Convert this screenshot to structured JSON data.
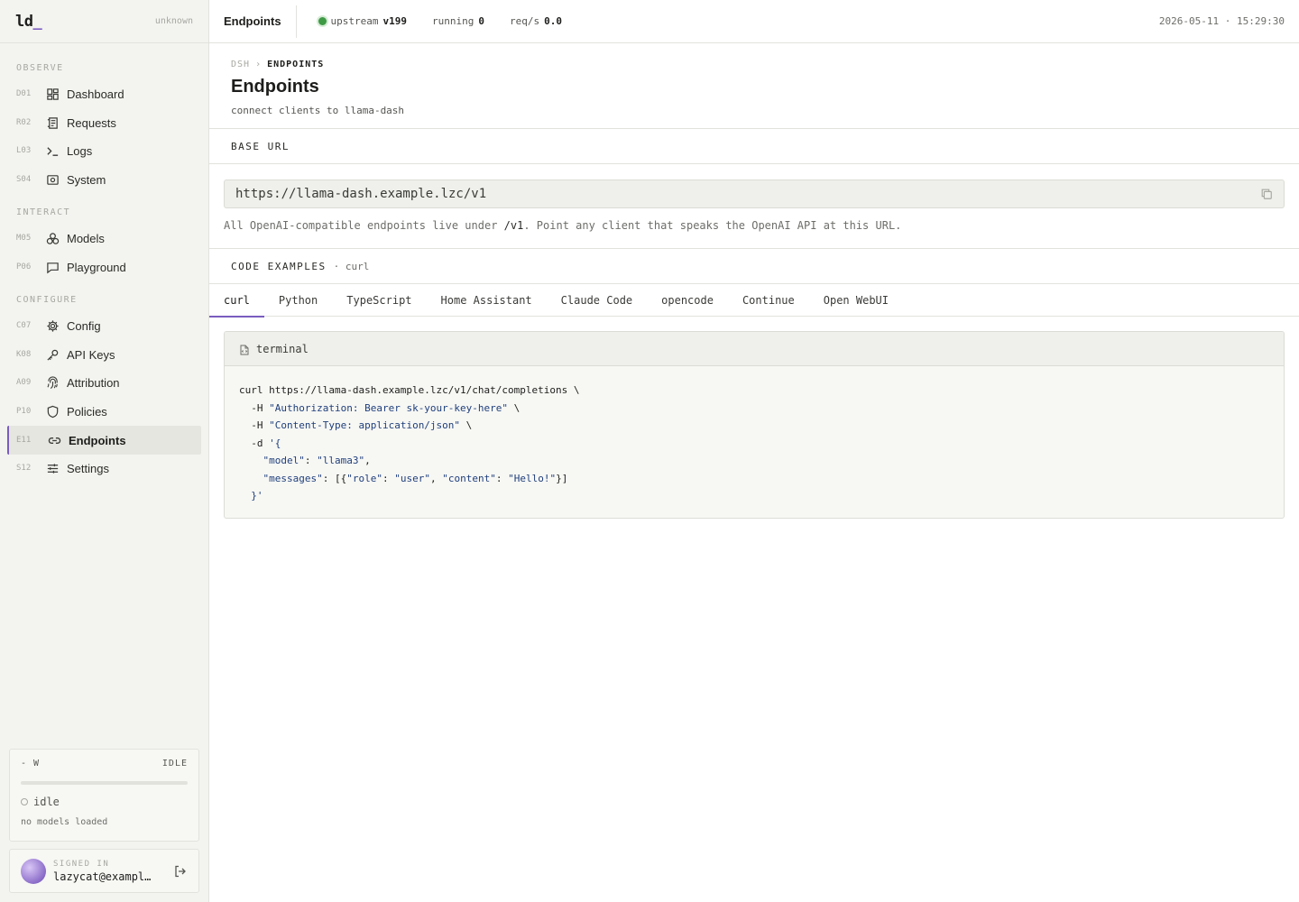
{
  "brand": {
    "logo": "ld",
    "cursor": "_",
    "status": "unknown"
  },
  "nav": {
    "sections": [
      {
        "label": "OBSERVE"
      },
      {
        "label": "INTERACT"
      },
      {
        "label": "CONFIGURE"
      }
    ],
    "items": [
      {
        "code": "D01",
        "label": "Dashboard",
        "icon": "dashboard-icon"
      },
      {
        "code": "R02",
        "label": "Requests",
        "icon": "requests-icon"
      },
      {
        "code": "L03",
        "label": "Logs",
        "icon": "terminal-icon"
      },
      {
        "code": "S04",
        "label": "System",
        "icon": "system-icon"
      },
      {
        "code": "M05",
        "label": "Models",
        "icon": "models-icon"
      },
      {
        "code": "P06",
        "label": "Playground",
        "icon": "chat-icon"
      },
      {
        "code": "C07",
        "label": "Config",
        "icon": "gear-icon"
      },
      {
        "code": "K08",
        "label": "API Keys",
        "icon": "key-icon"
      },
      {
        "code": "A09",
        "label": "Attribution",
        "icon": "fingerprint-icon"
      },
      {
        "code": "P10",
        "label": "Policies",
        "icon": "shield-icon"
      },
      {
        "code": "E11",
        "label": "Endpoints",
        "icon": "link-icon",
        "active": true
      },
      {
        "code": "S12",
        "label": "Settings",
        "icon": "sliders-icon"
      }
    ]
  },
  "gpu": {
    "power": "- W",
    "state_badge": "IDLE",
    "state": "idle",
    "note": "no models loaded"
  },
  "user": {
    "label": "SIGNED IN",
    "email": "lazycat@example.com"
  },
  "topbar": {
    "title": "Endpoints",
    "upstream_label": "upstream",
    "upstream_value": "v199",
    "running_label": "running",
    "running_value": "0",
    "reqs_label": "req/s",
    "reqs_value": "0.0",
    "datetime": "2026-05-11 · 15:29:30"
  },
  "page": {
    "crumb_root": "DSH",
    "crumb_sep": "›",
    "crumb_current": "ENDPOINTS",
    "title": "Endpoints",
    "subtitle": "connect clients to llama-dash"
  },
  "base_url": {
    "section_label": "BASE URL",
    "value": "https://llama-dash.example.lzc/v1",
    "help_before": "All OpenAI-compatible endpoints live under ",
    "help_code": "/v1",
    "help_after": ". Point any client that speaks the OpenAI API at this URL."
  },
  "examples": {
    "section_label": "CODE EXAMPLES",
    "section_meta": "· curl",
    "tabs": [
      "curl",
      "Python",
      "TypeScript",
      "Home Assistant",
      "Claude Code",
      "opencode",
      "Continue",
      "Open WebUI"
    ],
    "active_tab": 0,
    "card_title": "terminal",
    "code_lines": [
      "curl https://llama-dash.example.lzc/v1/chat/completions \\",
      "  -H \"Authorization: Bearer sk-your-key-here\" \\",
      "  -H \"Content-Type: application/json\" \\",
      "  -d '{",
      "    \"model\": \"llama3\",",
      "    \"messages\": [{\"role\": \"user\", \"content\": \"Hello!\"}]",
      "  }'"
    ]
  },
  "colors": {
    "accent": "#7a5cc0",
    "ok": "#3f9a46",
    "string": "#1f3f7a"
  }
}
